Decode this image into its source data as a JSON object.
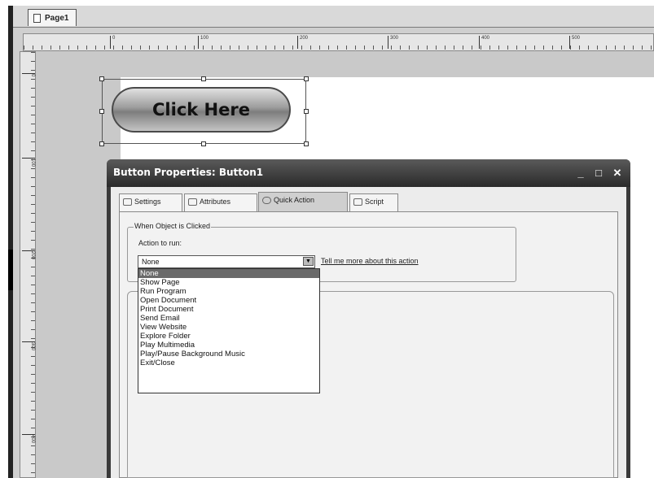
{
  "page_tab": {
    "label": "Page1"
  },
  "ruler": {
    "h_marks": [
      "0",
      "100",
      "200",
      "300",
      "400",
      "500"
    ],
    "v_marks": [
      "0",
      "100",
      "200",
      "300",
      "400"
    ]
  },
  "canvas": {
    "button_label": "Click Here"
  },
  "dialog": {
    "title": "Button Properties: Button1",
    "window_buttons": {
      "minimize": "_",
      "maximize": "□",
      "close": "✕"
    },
    "tabs": [
      {
        "label": "Settings",
        "icon": "settings-icon"
      },
      {
        "label": "Attributes",
        "icon": "attributes-icon"
      },
      {
        "label": "Quick Action",
        "icon": "quick-action-icon",
        "active": true
      },
      {
        "label": "Script",
        "icon": "script-icon"
      }
    ],
    "group_label": "When Object is Clicked",
    "action_label": "Action to run:",
    "action_value": "None",
    "help_link": "Tell me more about this action",
    "options": [
      "None",
      "Show Page",
      "Run Program",
      "Open Document",
      "Print Document",
      "Send Email",
      "View Website",
      "Explore Folder",
      "Play Multimedia",
      "Play/Pause Background Music",
      "Exit/Close"
    ],
    "selected_option": "None"
  }
}
